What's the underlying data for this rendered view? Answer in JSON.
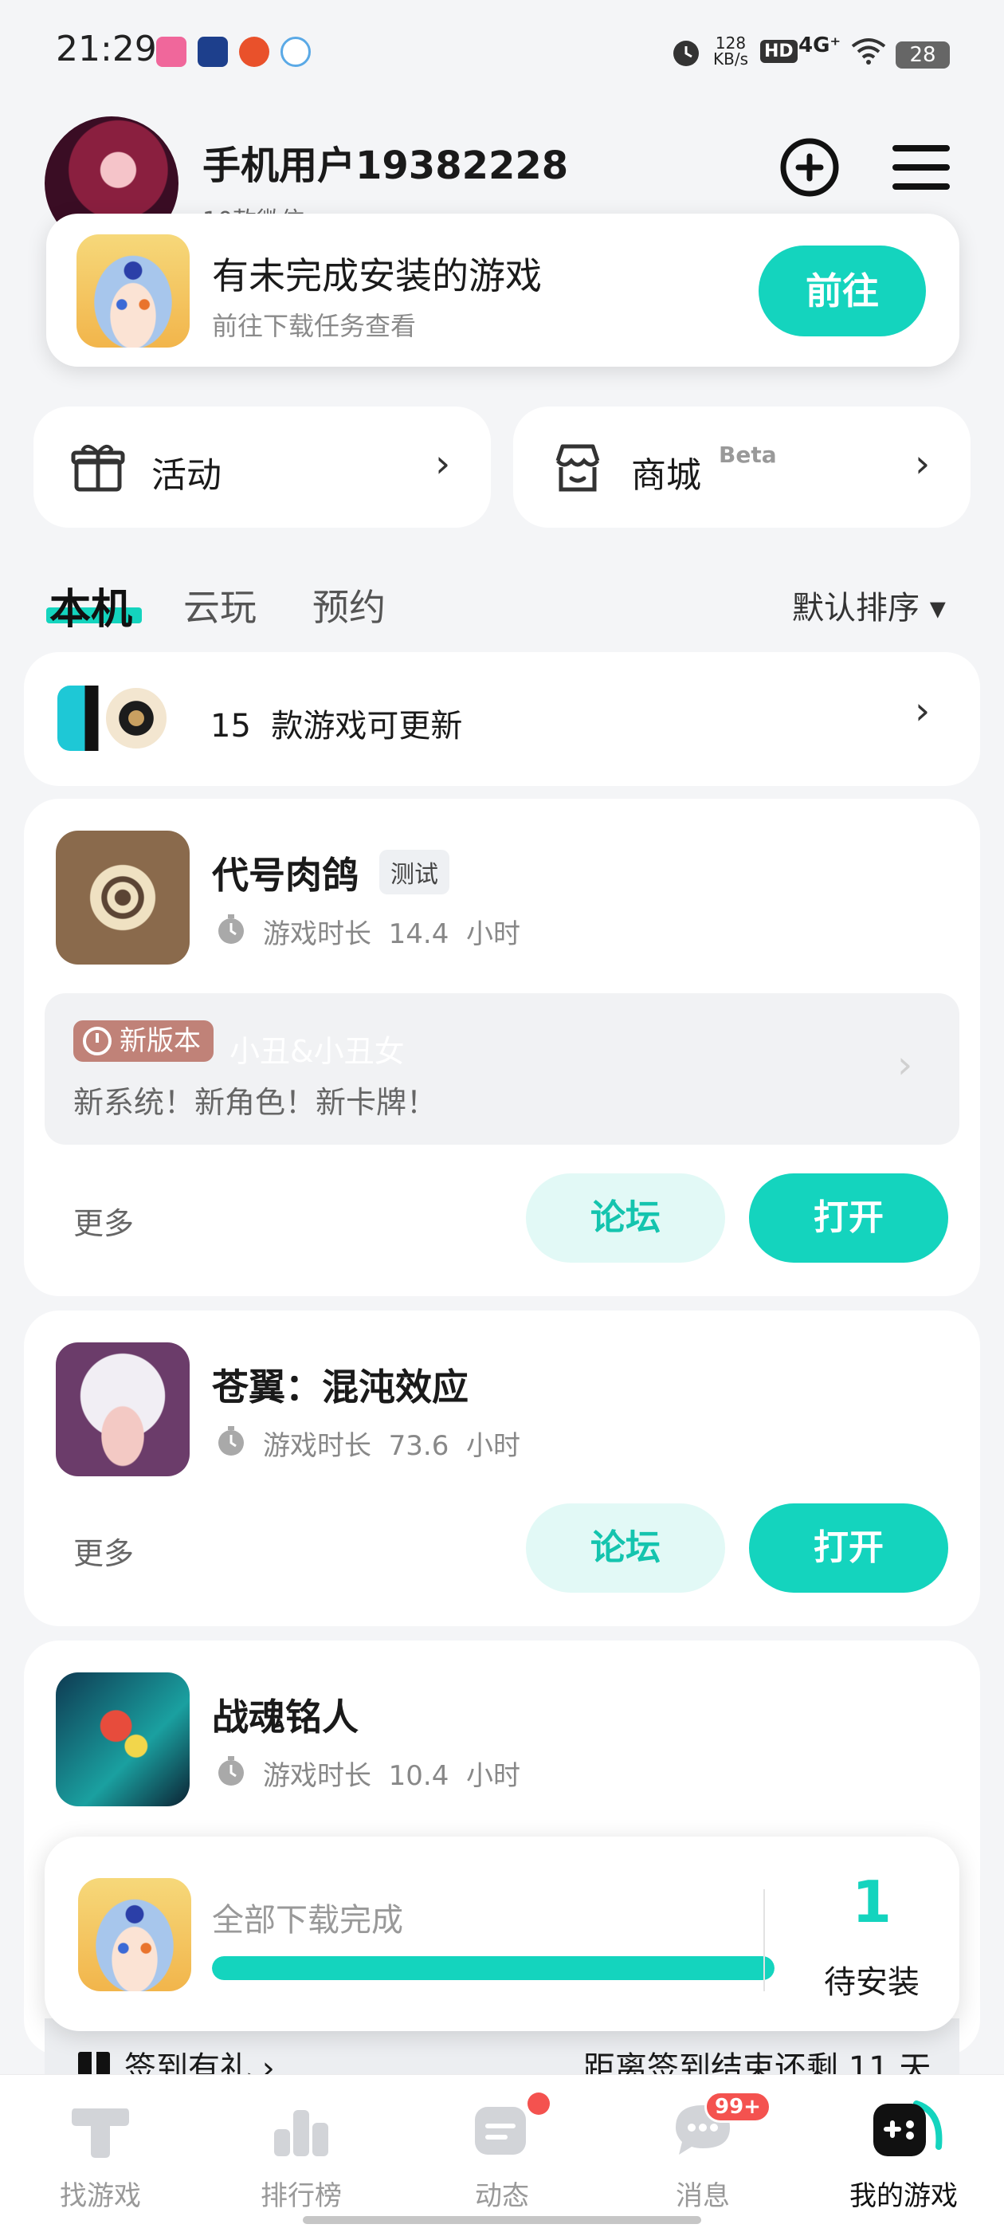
{
  "status_bar": {
    "time": "21:29",
    "net_speed_value": "128",
    "net_speed_unit": "KB/s",
    "hd": "HD",
    "network": "4G⁺",
    "battery": "28"
  },
  "header": {
    "username": "手机用户19382228",
    "subline": "10款微信 ›",
    "add_icon": "plus-circle-icon",
    "menu_icon": "menu-icon"
  },
  "pending_install": {
    "title": "有未完成安装的游戏",
    "subtitle": "前往下载任务查看",
    "button": "前往"
  },
  "quick_cards": [
    {
      "label": "活动",
      "icon": "gift-icon"
    },
    {
      "label": "商城",
      "badge": "Beta",
      "icon": "store-icon"
    }
  ],
  "tabs": [
    {
      "label": "本机",
      "active": true
    },
    {
      "label": "云玩",
      "active": false
    },
    {
      "label": "预约",
      "active": false
    }
  ],
  "sort": {
    "label": "默认排序 ▾"
  },
  "updates": {
    "count": "15",
    "text": "款游戏可更新"
  },
  "games": [
    {
      "name": "代号肉鸽",
      "badge": "测试",
      "playtime_label": "游戏时长",
      "playtime_value": "14.4",
      "playtime_unit": "小时",
      "news_tag": "新版本",
      "news_title": "小丑&小丑女",
      "news_body": "新系统！新角色！新卡牌！",
      "more": "更多",
      "forum": "论坛",
      "open": "打开"
    },
    {
      "name": "苍翼：混沌效应",
      "playtime_label": "游戏时长",
      "playtime_value": "73.6",
      "playtime_unit": "小时",
      "more": "更多",
      "forum": "论坛",
      "open": "打开"
    },
    {
      "name": "战魂铭人",
      "playtime_label": "游戏时长",
      "playtime_value": "10.4",
      "playtime_unit": "小时"
    }
  ],
  "download_bar": {
    "status": "全部下载完成",
    "progress": 1.0,
    "count": "1",
    "count_label": "待安装"
  },
  "checkin": {
    "label": "签到有礼 ›",
    "remaining": "距离签到结束还剩 11 天"
  },
  "bottom_nav": [
    {
      "label": "找游戏",
      "icon": "find-game-icon"
    },
    {
      "label": "排行榜",
      "icon": "ranking-icon"
    },
    {
      "label": "动态",
      "icon": "feed-icon"
    },
    {
      "label": "消息",
      "icon": "message-icon",
      "badge": "99+"
    },
    {
      "label": "我的游戏",
      "icon": "my-games-icon",
      "active": true
    }
  ],
  "colors": {
    "accent": "#14d4be",
    "accent_light": "#e2f9f6",
    "notification": "#f4524f",
    "background": "#f4f5f7"
  }
}
